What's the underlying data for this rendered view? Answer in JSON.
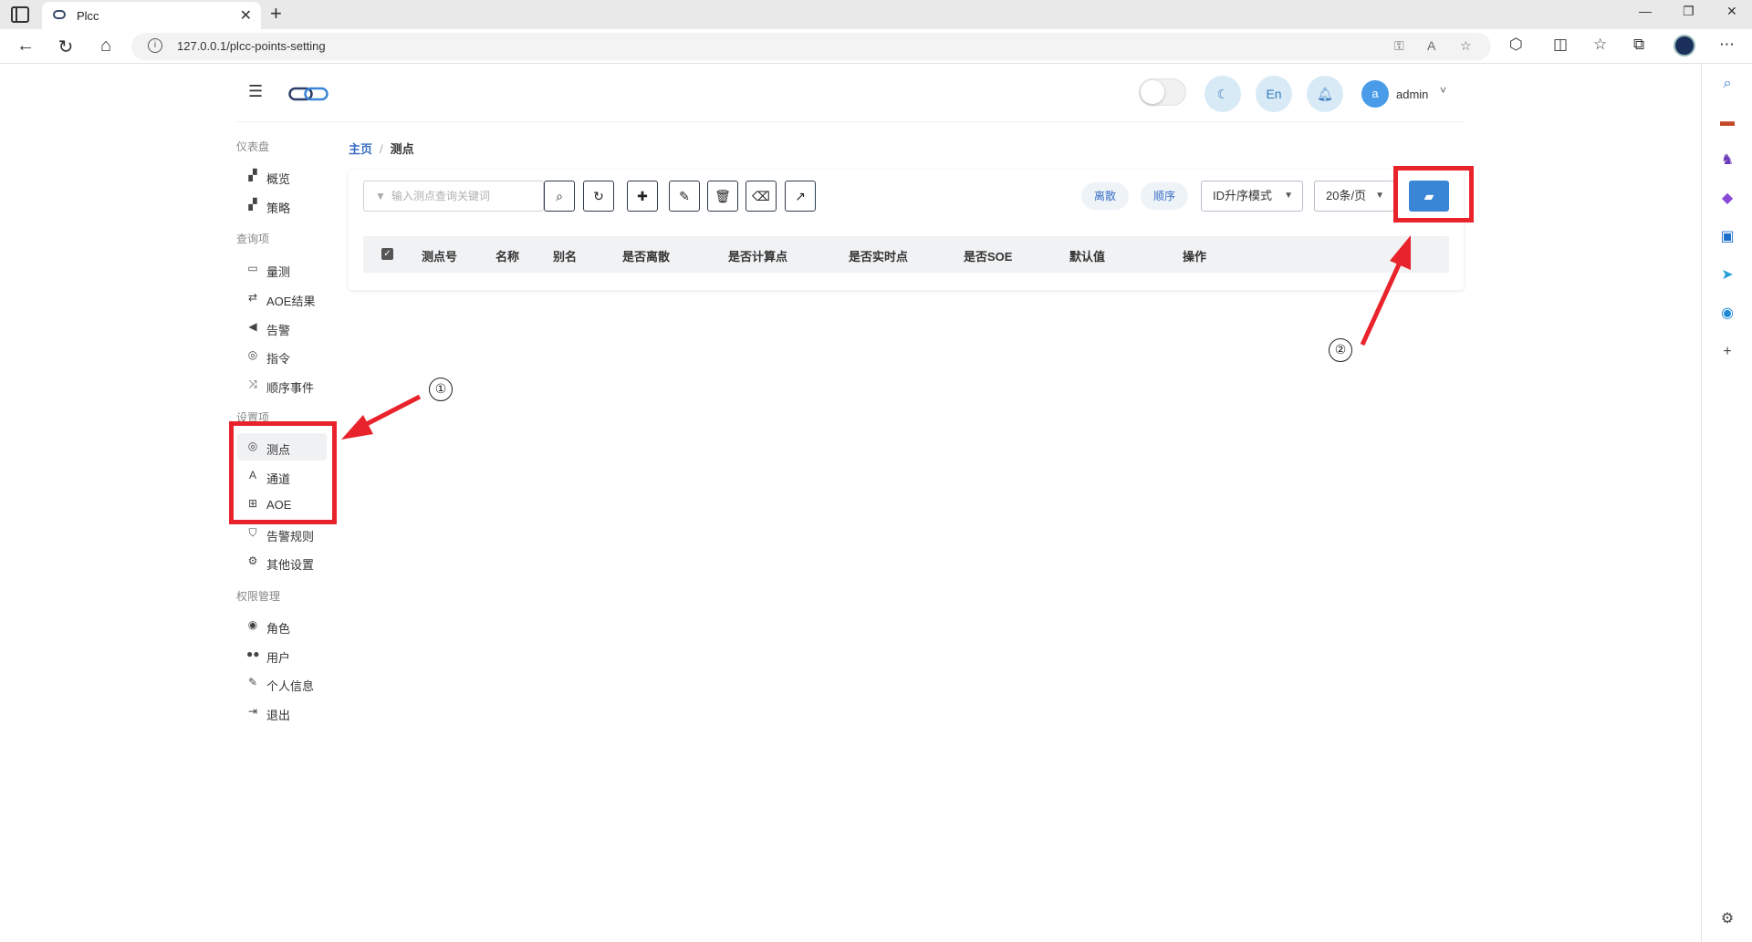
{
  "browser": {
    "tab_title": "Plcc",
    "tab_close": "✕",
    "new_tab": "+",
    "url": "127.0.0.1/plcc-points-setting",
    "window_controls": [
      "—",
      "❐",
      "✕"
    ]
  },
  "header": {
    "lang_label": "En",
    "user_avatar_letter": "a",
    "user_name": "admin"
  },
  "sidebar": {
    "groups": [
      {
        "label": "仪表盘",
        "items": [
          {
            "label": "概览",
            "icon": "dashboard-icon"
          },
          {
            "label": "策略",
            "icon": "strategy-icon"
          }
        ]
      },
      {
        "label": "查询项",
        "items": [
          {
            "label": "量测",
            "icon": "monitor-icon"
          },
          {
            "label": "AOE结果",
            "icon": "exchange-icon"
          },
          {
            "label": "告警",
            "icon": "bullhorn-icon"
          },
          {
            "label": "指令",
            "icon": "podcast-icon"
          },
          {
            "label": "顺序事件",
            "icon": "random-icon"
          }
        ]
      },
      {
        "label": "设置项",
        "items": [
          {
            "label": "测点",
            "icon": "podcast-icon",
            "active": true
          },
          {
            "label": "通道",
            "icon": "channel-icon"
          },
          {
            "label": "AOE",
            "icon": "sitemap-icon"
          },
          {
            "label": "告警规则",
            "icon": "shield-icon"
          },
          {
            "label": "其他设置",
            "icon": "cogs-icon"
          }
        ]
      },
      {
        "label": "权限管理",
        "items": [
          {
            "label": "角色",
            "icon": "user-circle-icon"
          },
          {
            "label": "用户",
            "icon": "users-icon"
          },
          {
            "label": "个人信息",
            "icon": "edit-icon"
          },
          {
            "label": "退出",
            "icon": "sign-out-icon"
          }
        ]
      }
    ]
  },
  "breadcrumb": {
    "home": "主页",
    "separator": "/",
    "current": "测点"
  },
  "toolbar": {
    "search_placeholder": "输入测点查询关键词",
    "buttons": [
      "search-icon",
      "refresh-icon",
      "plus-icon",
      "edit-icon",
      "trash-icon",
      "eraser-icon",
      "export-icon"
    ],
    "filter_discrete": "离散",
    "filter_order": "顺序",
    "sort_mode": "ID升序模式",
    "page_size": "20条/页"
  },
  "table": {
    "columns": [
      "测点号",
      "名称",
      "别名",
      "是否离散",
      "是否计算点",
      "是否实时点",
      "是否SOE",
      "默认值",
      "操作"
    ]
  },
  "annotations": {
    "marker_1": "①",
    "marker_2": "②",
    "color": "#e8232b"
  }
}
